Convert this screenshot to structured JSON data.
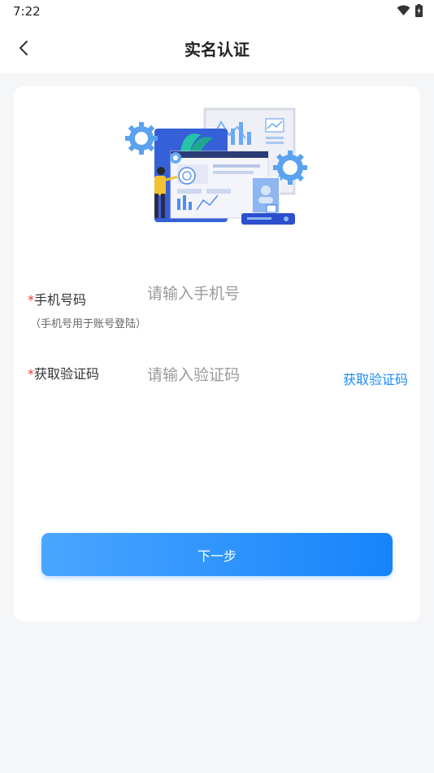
{
  "status_bar": {
    "time": "7:22",
    "icons": [
      "wifi-icon",
      "battery-charging-icon"
    ]
  },
  "nav": {
    "title": "实名认证",
    "back_icon": "chevron-left-icon"
  },
  "form": {
    "phone": {
      "required_mark": "*",
      "label": "手机号码",
      "hint": "（手机号用于账号登陆）",
      "placeholder": "请输入手机号",
      "value": ""
    },
    "code": {
      "required_mark": "*",
      "label": "获取验证码",
      "placeholder": "请输入验证码",
      "value": "",
      "get_code_label": "获取验证码"
    },
    "submit_label": "下一步"
  },
  "colors": {
    "accent": "#1a8cff",
    "required": "#e53935",
    "button_start": "#4aa6ff",
    "button_end": "#1784fb"
  }
}
